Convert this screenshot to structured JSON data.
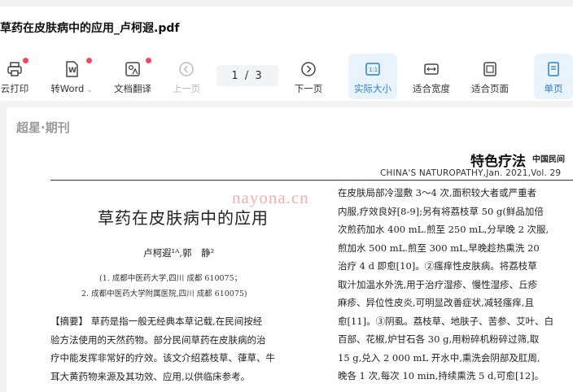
{
  "window": {
    "title": "草药在皮肤病中的应用_卢柯遐.pdf"
  },
  "toolbar": {
    "print_label": "云打印",
    "toword_label": "转Word",
    "translate_label": "文档翻译",
    "prev_label": "上一页",
    "page_indicator": "1 / 3",
    "next_label": "下一页",
    "actual_size_label": "实际大小",
    "fit_width_label": "适合宽度",
    "fit_page_label": "适合页面",
    "single_page_label": "单页"
  },
  "document": {
    "brand": "超星·期刊",
    "journal_name": "特色疗法",
    "journal_name_small": "中国民间",
    "journal_line": "CHINA'S NATUROPATHY,Jan. 2021,Vol. 29",
    "article_title": "草药在皮肤病中的应用",
    "authors": "卢柯遐¹ᴬ,郭　静²",
    "affiliation_1": "(1. 成都中医药大学,四川 成都 610075；",
    "affiliation_2": "2. 成都中医药大学附属医院,四川 成都 610075)",
    "abstract_lines": [
      "【摘要】 草药是指一般无经典本草记载,在民间按经",
      "验方法使用的天然药物。部分民间草药在皮肤病的治",
      "疗中能发挥非常好的疗效。该文介绍荔枝草、葎草、牛",
      "耳大黄药物来源及其功效、应用,以供临床参考。"
    ],
    "right_lines": [
      "在皮肤局部冷湿敷 3～4 次,面积较大者或严重者",
      "内服,疗效良好[8-9];另有将荔枝草 50 g(鲜品加倍",
      "次煎药加水 400 mL.煎至 250 mL,分早晚 2 次服,",
      "煎加水 500 mL.煎至 300 mL,早晚趁热熏洗 20",
      "治疗 4 d 即愈[10]。②瘙痒性皮肤病。将荔枝草",
      "取汁加温水外洗,用于治疗湿疹、慢性湿疹、丘疹",
      "麻疹、异位性皮炎,可明显改善症状,减轻瘙痒,且",
      "愈[11]。③阴虱。荔枝草、地肤子、苦参、艾叶、白",
      "百部、花椒,炉甘石各 30 g,用粉碎机粉碎过筛,取",
      "15 g,兑入 2 000 mL 开水中,熏洗会阴部及肛周,",
      "晚各 1 次,每次 10 min,持续熏洗 5 d,可愈[12]。"
    ],
    "watermark": "nayona.cn"
  }
}
